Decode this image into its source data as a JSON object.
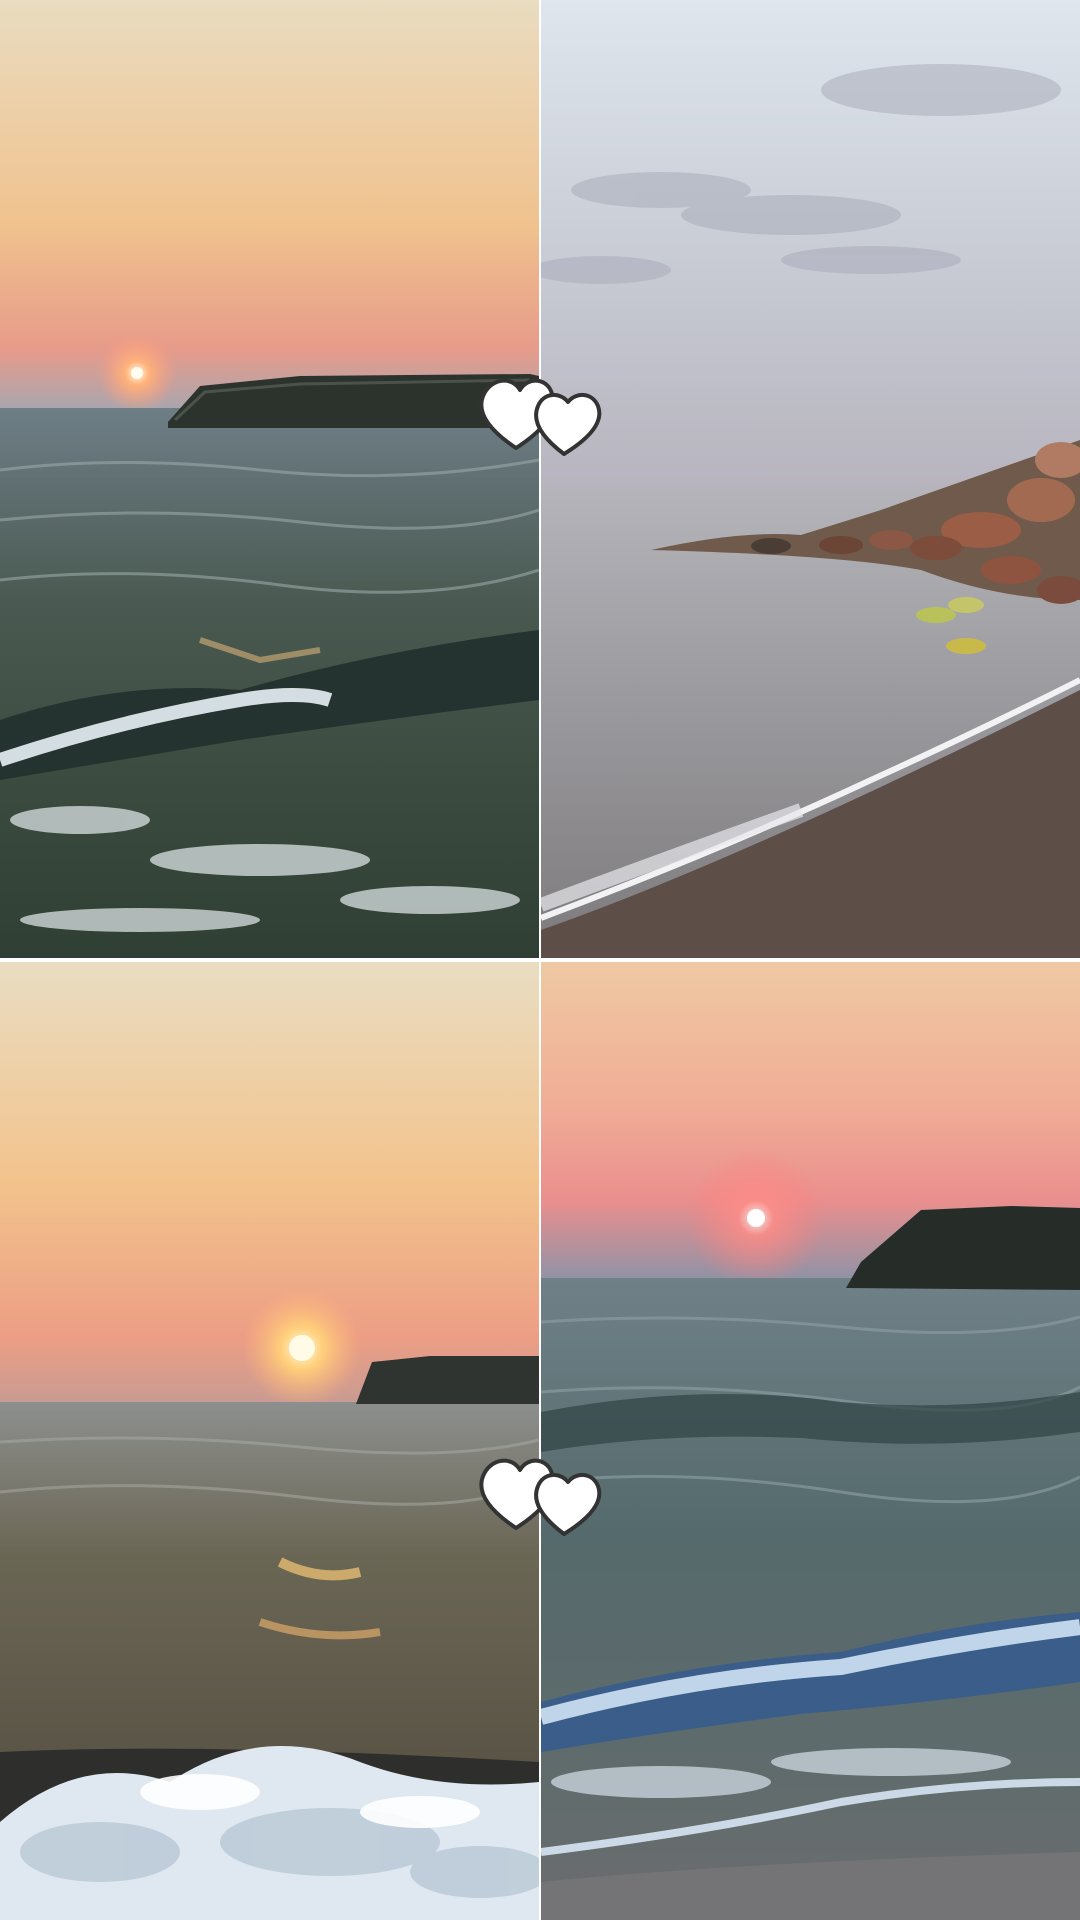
{
  "collage": {
    "layout": "2x2 grid",
    "panels": [
      {
        "scene": "sunset-over-sea-with-breakwater",
        "palette": {
          "sky_top": "#e9dcc0",
          "sky_mid": "#f0c28e",
          "sky_low": "#e79b8a",
          "sea": "#3e4c46",
          "rocks": "#2b322d"
        }
      },
      {
        "scene": "overcast-beach-with-rocks",
        "palette": {
          "sky_top": "#dfe6ee",
          "sky_low": "#b9b8c2",
          "sea": "#8f8f92",
          "sand": "#5d4f47",
          "rocks": "#8c5a45"
        }
      },
      {
        "scene": "golden-sunset-waves",
        "palette": {
          "sky_top": "#e9ddc2",
          "sky_mid": "#f3c38c",
          "sky_low": "#e99b84",
          "sea": "#5a5446",
          "foam": "#e8eef4"
        }
      },
      {
        "scene": "pink-sunset-blue-waves",
        "palette": {
          "sky_top": "#efc9a3",
          "sky_mid": "#eea08f",
          "sky_low": "#8f8f9e",
          "sea": "#556a6c",
          "foam": "#dfeaf4"
        }
      }
    ]
  },
  "stickers": [
    {
      "icon": "double-heart-icon",
      "fill": "#ffffff",
      "stroke": "#333333"
    },
    {
      "icon": "double-heart-icon",
      "fill": "#ffffff",
      "stroke": "#333333"
    }
  ]
}
